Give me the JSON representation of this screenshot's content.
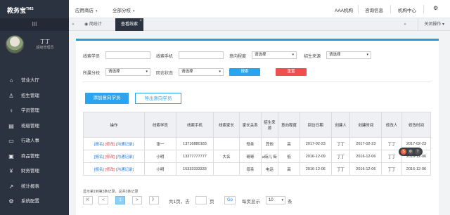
{
  "app": {
    "title": "教务宝",
    "tm": "TMS"
  },
  "header": {
    "menu1": "应用商店",
    "menu2": "全部分校",
    "org": "AAA机构",
    "messages": "咨询信息",
    "center": "机构中心"
  },
  "sidebar": {
    "toggle": "III",
    "user_name": "丁丁",
    "user_role": "超级管理员",
    "items": [
      {
        "label": "营业大厅",
        "icon": "home-icon"
      },
      {
        "label": "招生管理",
        "icon": "user-add-icon"
      },
      {
        "label": "学员管理",
        "icon": "user-icon"
      },
      {
        "label": "班级管理",
        "icon": "class-icon"
      },
      {
        "label": "行政人事",
        "icon": "admin-icon"
      },
      {
        "label": "商品管理",
        "icon": "goods-icon"
      },
      {
        "label": "财务管理",
        "icon": "yen-icon"
      },
      {
        "label": "统计报表",
        "icon": "chart-icon"
      },
      {
        "label": "系统配置",
        "icon": "gear-icon"
      }
    ]
  },
  "tabs": {
    "prev": "«",
    "next": "»",
    "items": [
      "◉ 简统计",
      "查看线索"
    ],
    "close_ops": "关闭操作 ▾"
  },
  "filters": {
    "student_label": "线索学员",
    "phone_label": "线索手机",
    "intent_label": "意向程度",
    "intent_value": "请选择",
    "source_label": "招生来源",
    "source_value": "请选择",
    "branch_label": "所属分校",
    "branch_value": "请选择",
    "visit_label": "回访状态",
    "visit_value": "请选择",
    "search_btn": "搜索",
    "reset_btn": "重置"
  },
  "actions": {
    "add": "添加意向学员",
    "export": "导出意向学员"
  },
  "table": {
    "columns": [
      "操作",
      "线索学员",
      "线索手机",
      "线索家长",
      "家长关系",
      "招生来源",
      "意向程度",
      "回访日期",
      "创建人",
      "创建时间",
      "修改人",
      "修改时间"
    ],
    "op_links": [
      "[报名]",
      "[修改]",
      "[沟通记录]"
    ],
    "rows": [
      [
        "张一",
        "13716880183",
        "",
        "母亲",
        "其他",
        "高",
        "2017-02-23",
        "丁丁",
        "2017-02-23",
        "丁丁",
        "2017-02-23"
      ],
      [
        "小明",
        "13377777777",
        "大名",
        "哥哥",
        "a街儿\n街",
        "低",
        "2016-12-09",
        "丁丁",
        "2016-12-06",
        "丁丁",
        "2016-12-06"
      ],
      [
        "小明",
        "15333333333",
        "",
        "母亲",
        "电话",
        "高",
        "2016-12-06",
        "丁丁",
        "2016-12-06",
        "丁丁",
        "2016-12-06"
      ]
    ]
  },
  "pager": {
    "summary": "显示第1到第3条记录，总共3条记录",
    "first": "K",
    "prev": "<",
    "current": "1",
    "next": ">",
    "last": "》",
    "page_info_prefix": "共1页，去",
    "page_info_suffix": "页",
    "go": "Go",
    "per_page_label": "每页显示",
    "per_page_value": "10",
    "per_page_suffix": "条"
  }
}
